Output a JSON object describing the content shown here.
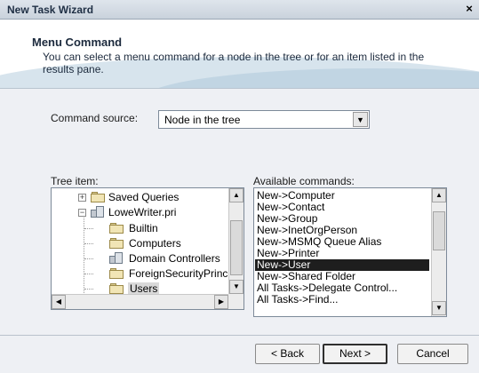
{
  "window": {
    "title": "New Task Wizard",
    "close_glyph": "×"
  },
  "header": {
    "title": "Menu Command",
    "description": "You can select a menu command for a node in the tree or for an item listed in the results pane."
  },
  "command_source": {
    "label": "Command source:",
    "value": "Node in the tree"
  },
  "tree": {
    "label": "Tree item:",
    "items": [
      {
        "text": "Saved Queries",
        "icon": "folder-icon",
        "expander": "+"
      },
      {
        "text": "LoweWriter.pri",
        "icon": "domain-icon",
        "expander": "−"
      },
      {
        "text": "Builtin",
        "icon": "folder-icon"
      },
      {
        "text": "Computers",
        "icon": "folder-icon"
      },
      {
        "text": "Domain Controllers",
        "icon": "ou-icon"
      },
      {
        "text": "ForeignSecurityPrincip",
        "icon": "folder-icon"
      },
      {
        "text": "Users",
        "icon": "folder-icon",
        "selected": true
      }
    ]
  },
  "commands": {
    "label": "Available commands:",
    "items": [
      "New->Computer",
      "New->Contact",
      "New->Group",
      "New->InetOrgPerson",
      "New->MSMQ Queue Alias",
      "New->Printer",
      "New->User",
      "New->Shared Folder",
      "All Tasks->Delegate Control...",
      "All Tasks->Find..."
    ],
    "selected_index": 6
  },
  "buttons": {
    "back": "< Back",
    "next": "Next >",
    "cancel": "Cancel"
  },
  "colors": {
    "selection": "#1e1e1e",
    "dialog_bg": "#eef0f4",
    "header_accent": "#aec8da"
  }
}
